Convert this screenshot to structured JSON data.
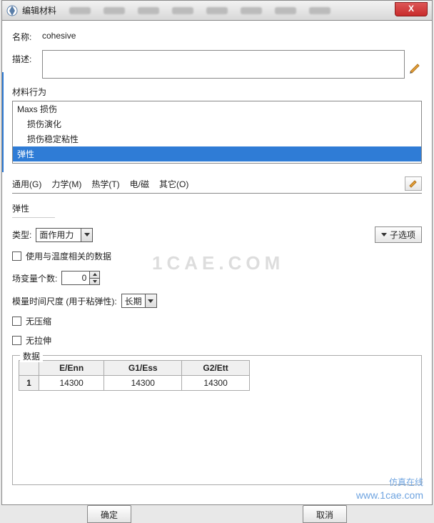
{
  "titlebar": {
    "title": "编辑材料",
    "close_label": "X"
  },
  "name": {
    "label": "名称:",
    "value": "cohesive"
  },
  "desc": {
    "label": "描述:",
    "value": ""
  },
  "behavior": {
    "label": "材料行为",
    "items": [
      {
        "text": "Maxs 损伤",
        "indent": 0
      },
      {
        "text": "损伤演化",
        "indent": 1
      },
      {
        "text": "损伤稳定粘性",
        "indent": 1
      },
      {
        "text": "弹性",
        "indent": 0,
        "selected": true
      }
    ]
  },
  "tabs": {
    "general": "通用(G)",
    "mechanics": "力学(M)",
    "thermal": "热学(T)",
    "em": "电/磁",
    "other": "其它(O)"
  },
  "elastic": {
    "heading": "弹性",
    "type_label": "类型:",
    "type_value": "面作用力",
    "suboptions": "子选项",
    "temp_data": "使用与温度相关的数据",
    "field_vars_label": "场变量个数:",
    "field_vars_value": "0",
    "modulus_time_label": "模量时间尺度 (用于粘弹性):",
    "modulus_time_value": "长期",
    "no_compression": "无压缩",
    "no_tension": "无拉伸"
  },
  "data": {
    "legend": "数据",
    "headers": [
      "E/Enn",
      "G1/Ess",
      "G2/Ett"
    ],
    "rows": [
      {
        "n": "1",
        "cells": [
          "14300",
          "14300",
          "14300"
        ]
      }
    ]
  },
  "buttons": {
    "ok": "确定",
    "cancel": "取消"
  },
  "watermark": {
    "big": "1CAE.COM",
    "brand": "仿真在线",
    "url": "www.1cae.com"
  }
}
